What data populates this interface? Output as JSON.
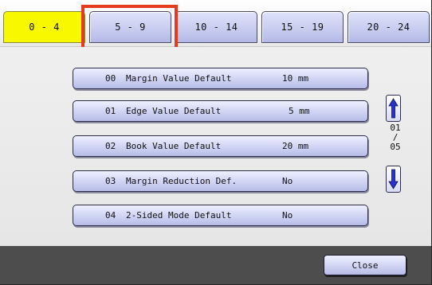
{
  "tabs": [
    {
      "label": "0 - 4",
      "active": true
    },
    {
      "label": "5 - 9",
      "active": false
    },
    {
      "label": "10 - 14",
      "active": false
    },
    {
      "label": "15 - 19",
      "active": false
    },
    {
      "label": "20 - 24",
      "active": false
    }
  ],
  "items": [
    {
      "num": "00",
      "name": "Margin Value Default",
      "value": "10 mm"
    },
    {
      "num": "01",
      "name": "Edge Value Default",
      "value": "5 mm"
    },
    {
      "num": "02",
      "name": "Book Value Default",
      "value": "20 mm"
    },
    {
      "num": "03",
      "name": "Margin Reduction Def.",
      "value": "No"
    },
    {
      "num": "04",
      "name": "2-Sided Mode Default",
      "value": "No"
    }
  ],
  "pager": {
    "current": "01",
    "separator": "/",
    "total": "05"
  },
  "footer": {
    "close_label": "Close"
  },
  "colors": {
    "active_tab": "#f8f800",
    "highlight": "#e63a1e",
    "button": "#c9cef0",
    "footer": "#4d4d4d"
  },
  "icons": {
    "scroll_up": "arrow-up-icon",
    "scroll_down": "arrow-down-icon"
  }
}
